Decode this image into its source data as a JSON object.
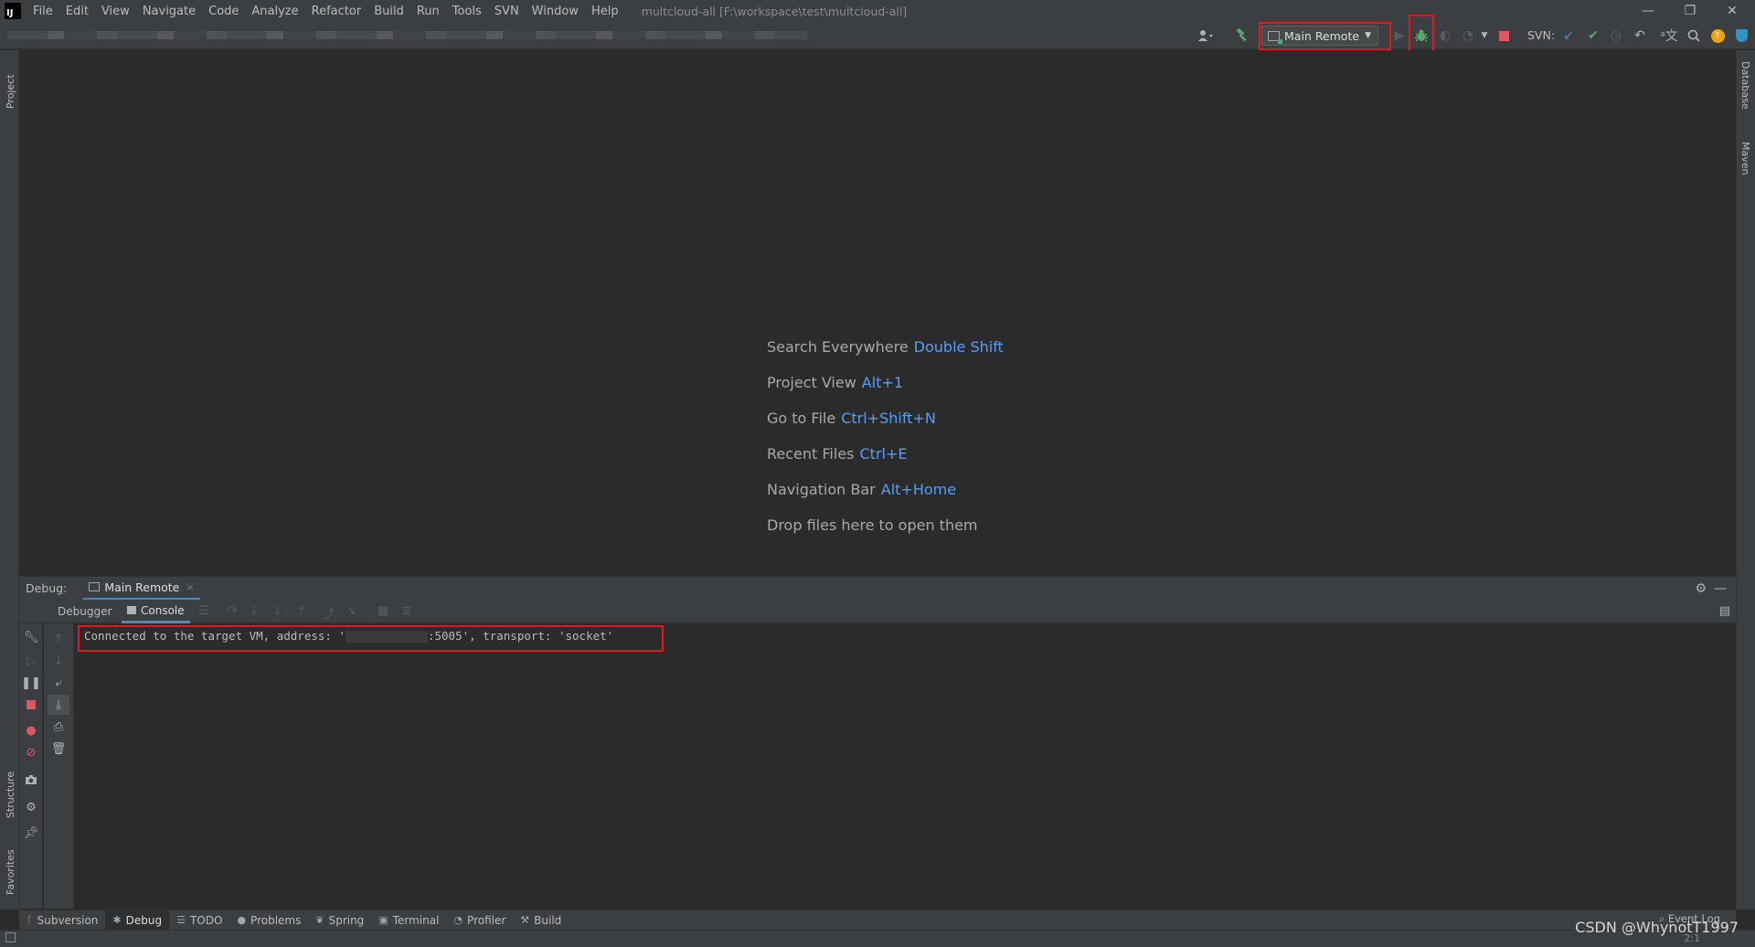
{
  "menubar": {
    "logo": "IJ",
    "items": [
      "File",
      "Edit",
      "View",
      "Navigate",
      "Code",
      "Analyze",
      "Refactor",
      "Build",
      "Run",
      "Tools",
      "SVN",
      "Window",
      "Help"
    ],
    "window_title": "multcloud-all [F:\\workspace\\test\\multcloud-all]",
    "controls": {
      "minimize": "—",
      "restore": "❐",
      "close": "✕"
    }
  },
  "toolbar": {
    "run_config": "Main Remote",
    "svn_label": "SVN:"
  },
  "stripes": {
    "left_top": "Project",
    "left_structure": "Structure",
    "left_favorites": "Favorites",
    "right_database": "Database",
    "right_maven": "Maven"
  },
  "editor": {
    "hints": [
      {
        "label": "Search Everywhere",
        "key": "Double Shift"
      },
      {
        "label": "Project View",
        "key": "Alt+1"
      },
      {
        "label": "Go to File",
        "key": "Ctrl+Shift+N"
      },
      {
        "label": "Recent Files",
        "key": "Ctrl+E"
      },
      {
        "label": "Navigation Bar",
        "key": "Alt+Home"
      }
    ],
    "drop_text": "Drop files here to open them"
  },
  "debug": {
    "title": "Debug:",
    "tab_label": "Main Remote",
    "tab_close": "×",
    "subtabs": [
      "Debugger",
      "Console"
    ],
    "console_line_prefix": "Connected to the target VM, address: '",
    "console_line_suffix": ":5005', transport: 'socket'"
  },
  "bottom_tabs": [
    "Subversion",
    "Debug",
    "TODO",
    "Problems",
    "Spring",
    "Terminal",
    "Profiler",
    "Build"
  ],
  "status": {
    "event_log": "Event Log",
    "position": "2:1"
  },
  "watermark": "CSDN @WhynotT1997",
  "colors": {
    "accent_blue": "#589df6",
    "highlight_red": "#e0191f",
    "debug_green": "#59a869"
  }
}
